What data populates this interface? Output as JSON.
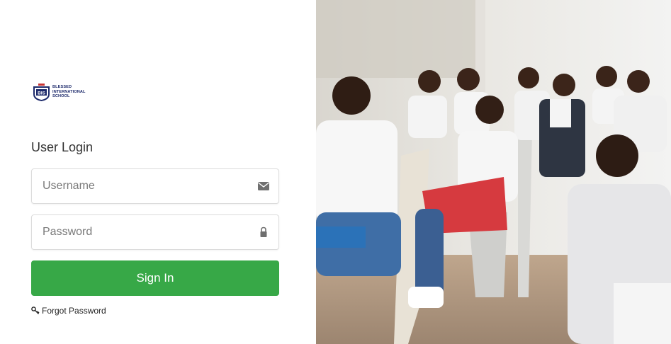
{
  "brand": {
    "logo_lines": [
      "BLESSED",
      "INTERNATIONAL",
      "SCHOOL"
    ],
    "logo_initials": "BIS",
    "primary_color": "#1d2a6b"
  },
  "login": {
    "title": "User Login",
    "username_placeholder": "Username",
    "username_icon": "envelope-icon",
    "password_placeholder": "Password",
    "password_icon": "lock-icon",
    "submit_label": "Sign In",
    "submit_color": "#37a847",
    "forgot_label": "Forgot Password",
    "forgot_icon": "key-icon"
  },
  "hero_image": {
    "subject": "students-in-classroom-photo"
  }
}
